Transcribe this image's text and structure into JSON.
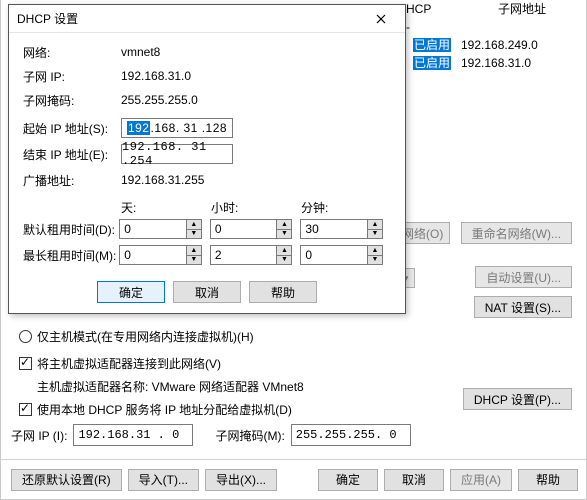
{
  "behind": {
    "col_dhcp": "HCP",
    "col_subnet": "子网地址",
    "enabled": "已启用",
    "v1": "-",
    "v2": "192.168.249.0",
    "v3": "192.168.31.0",
    "net_o_btn": "网络(O)",
    "rename_btn": "重命名网络(W)...",
    "auto_btn": "自动设置(U)...",
    "nat_btn": "NAT 设置(S)...",
    "dhcp_btn": "DHCP 设置(P)...",
    "host_only_radio": "仅主机模式(在专用网络内连接虚拟机)(H)",
    "connect_adapter": "将主机虚拟适配器连接到此网络(V)",
    "adapter_name_label": "主机虚拟适配器名称: VMware 网络适配器 VMnet8",
    "use_dhcp": "使用本地 DHCP 服务将 IP 地址分配给虚拟机(D)",
    "subnet_ip_label": "子网 IP (I):",
    "subnet_ip_value": "192.168.31 . 0",
    "subnet_mask_label": "子网掩码(M):",
    "subnet_mask_value": "255.255.255. 0",
    "restore_btn": "还原默认设置(R)",
    "import_btn": "导入(T)...",
    "export_btn": "导出(X)...",
    "ok_btn": "确定",
    "cancel_btn": "取消",
    "apply_btn": "应用(A)",
    "help_btn": "帮助"
  },
  "dlg": {
    "title": "DHCP 设置",
    "net_label": "网络:",
    "net_value": "vmnet8",
    "subnet_ip_label": "子网 IP:",
    "subnet_ip_value": "192.168.31.0",
    "subnet_mask_label": "子网掩码:",
    "subnet_mask_value": "255.255.255.0",
    "start_ip_label": "起始 IP 地址(S):",
    "start_ip_sel": "192",
    "start_ip_rest": ".168. 31 .128",
    "end_ip_label": "结束 IP 地址(E):",
    "end_ip_value": "192.168. 31 .254",
    "bcast_label": "广播地址:",
    "bcast_value": "192.168.31.255",
    "days": "天:",
    "hours": "小时:",
    "minutes": "分钟:",
    "def_lease_label": "默认租用时间(D):",
    "max_lease_label": "最长租用时间(M):",
    "def_d": "0",
    "def_h": "0",
    "def_m": "30",
    "max_d": "0",
    "max_h": "2",
    "max_m": "0",
    "ok": "确定",
    "cancel": "取消",
    "help": "帮助"
  }
}
